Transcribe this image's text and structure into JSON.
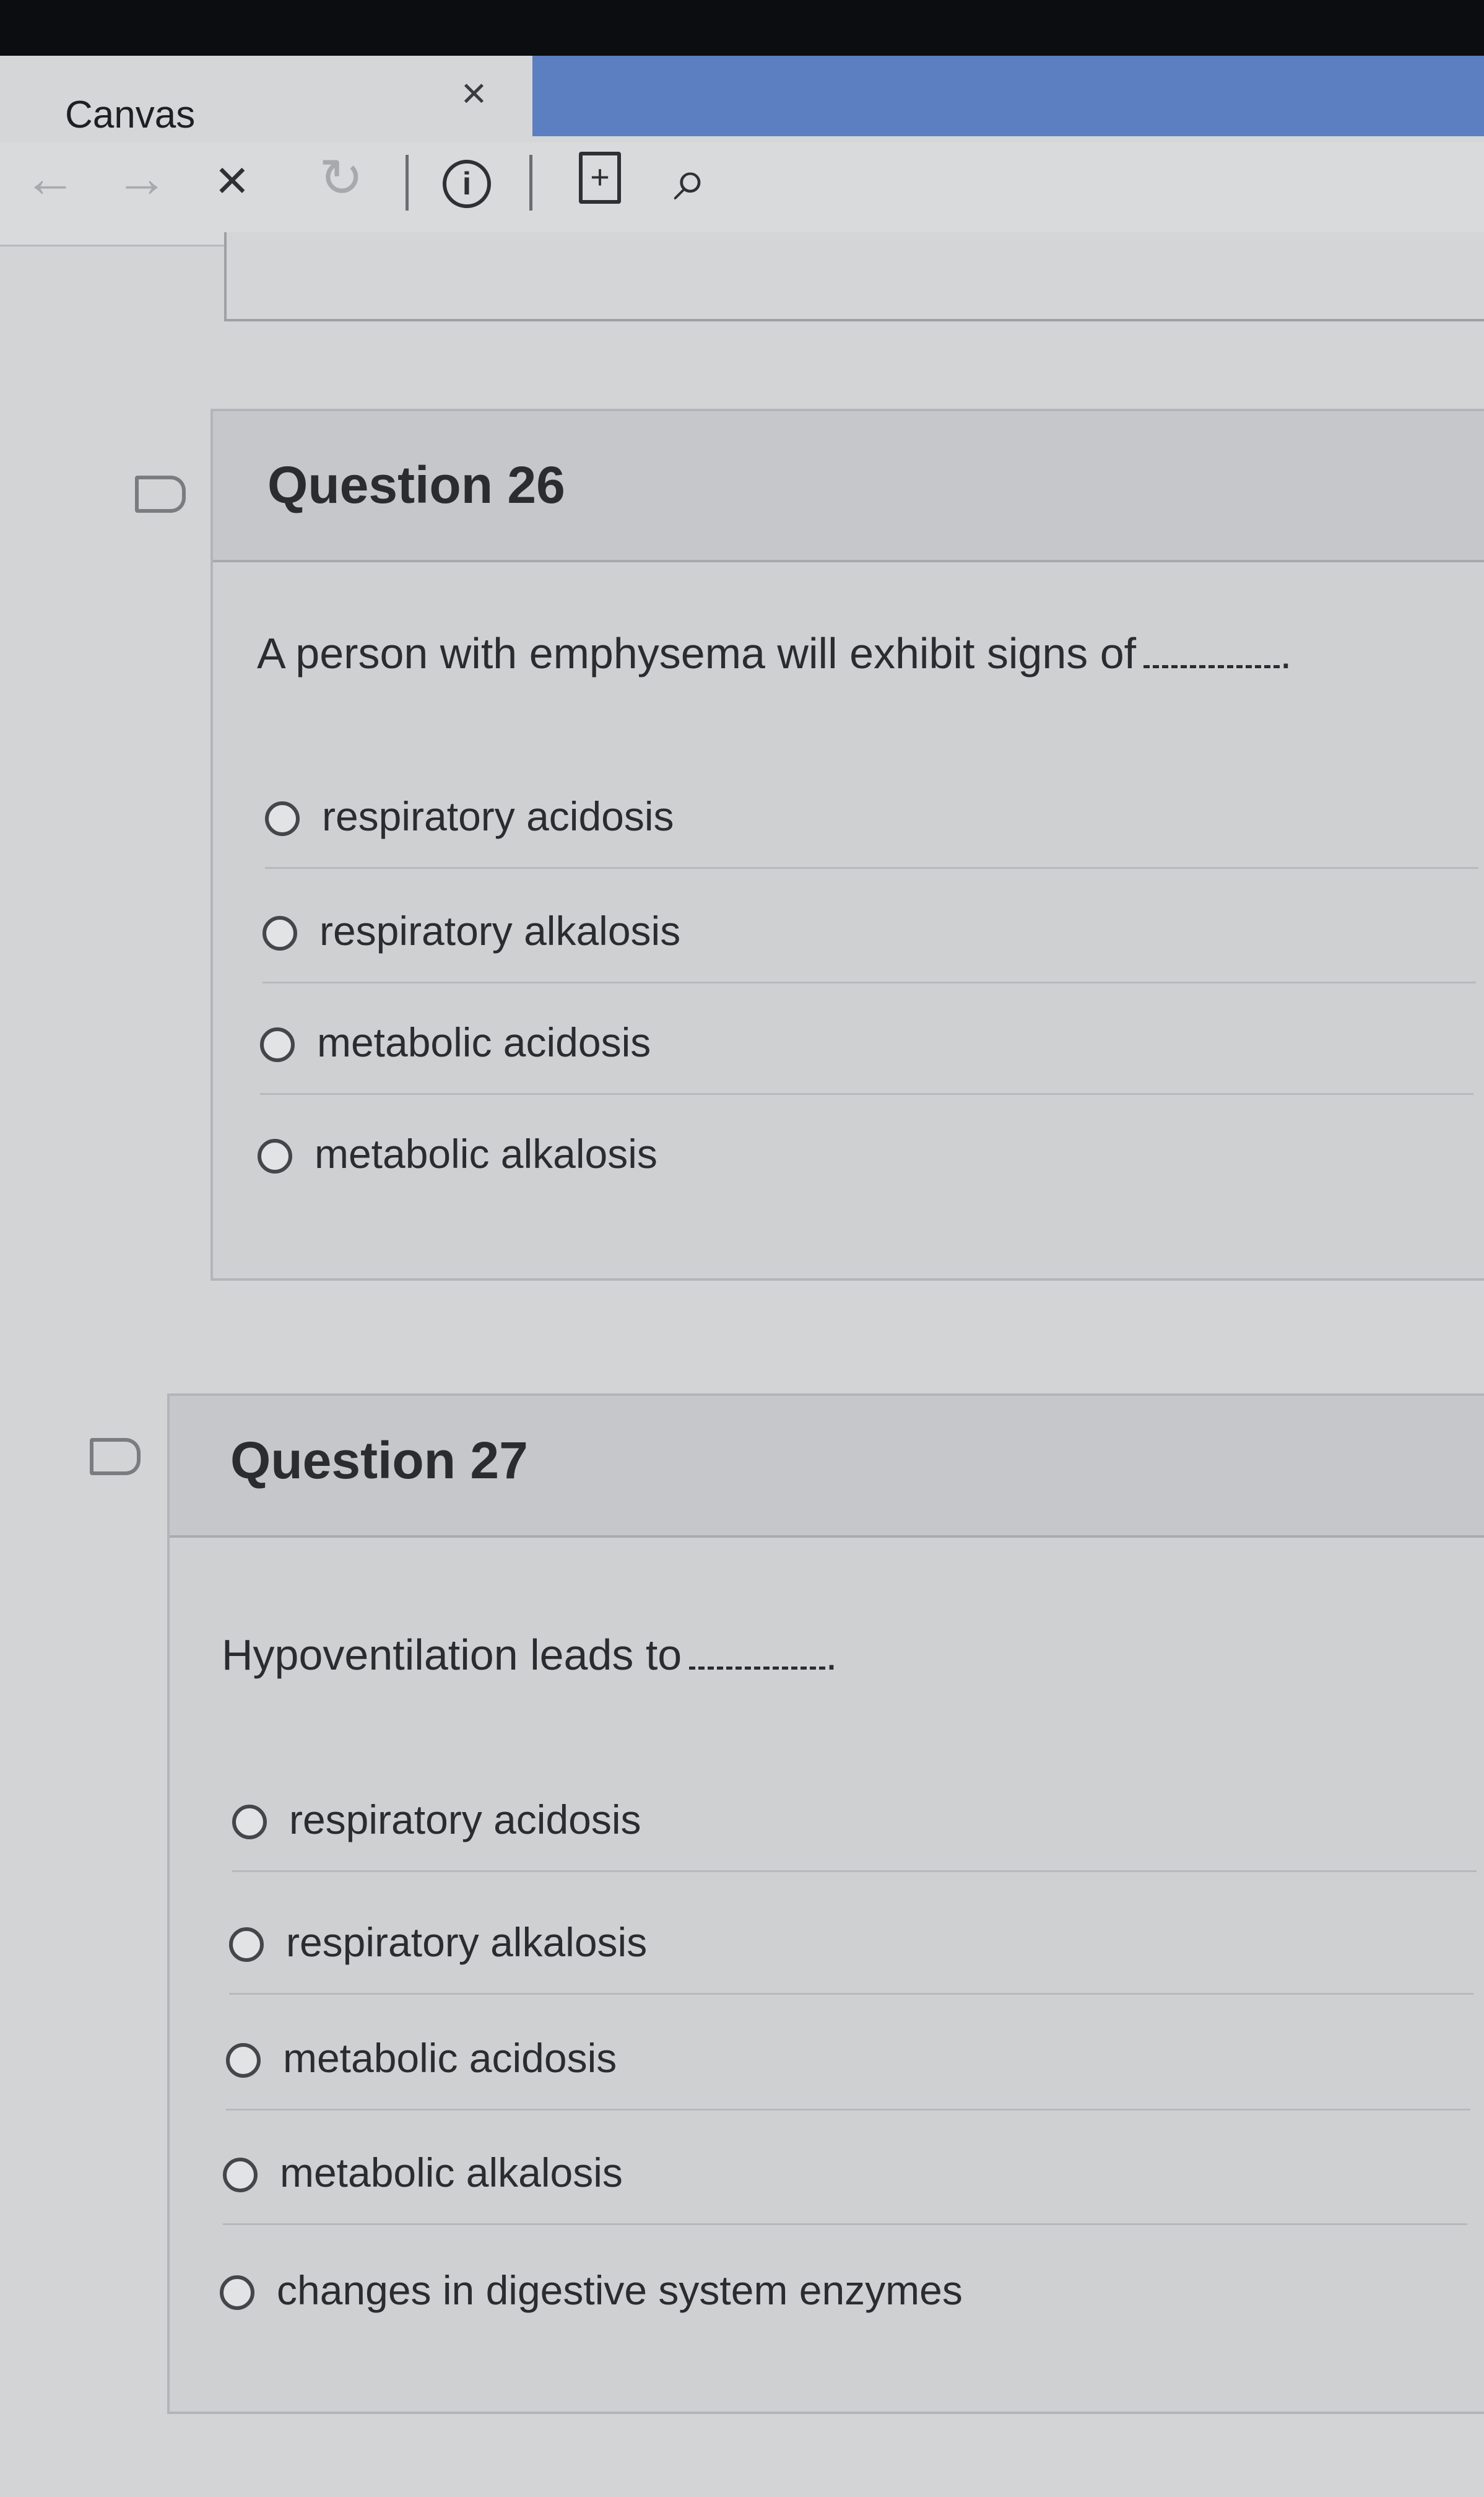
{
  "browser": {
    "title": "Canvas",
    "tab_close": "×",
    "toolbar": {
      "back": "←",
      "forward": "→",
      "stop": "×",
      "reload": "↻",
      "info": "i",
      "add_page": "+",
      "search": "⌕"
    }
  },
  "quiz": {
    "questions": [
      {
        "title": "Question 26",
        "text": "A person with emphysema will exhibit signs of",
        "blank_suffix": ".",
        "answers": [
          "respiratory acidosis",
          "respiratory alkalosis",
          "metabolic acidosis",
          "metabolic alkalosis"
        ]
      },
      {
        "title": "Question 27",
        "text": "Hypoventilation leads to",
        "blank_suffix": ".",
        "answers": [
          "respiratory acidosis",
          "respiratory alkalosis",
          "metabolic acidosis",
          "metabolic alkalosis",
          "changes in digestive system enzymes"
        ]
      }
    ]
  }
}
